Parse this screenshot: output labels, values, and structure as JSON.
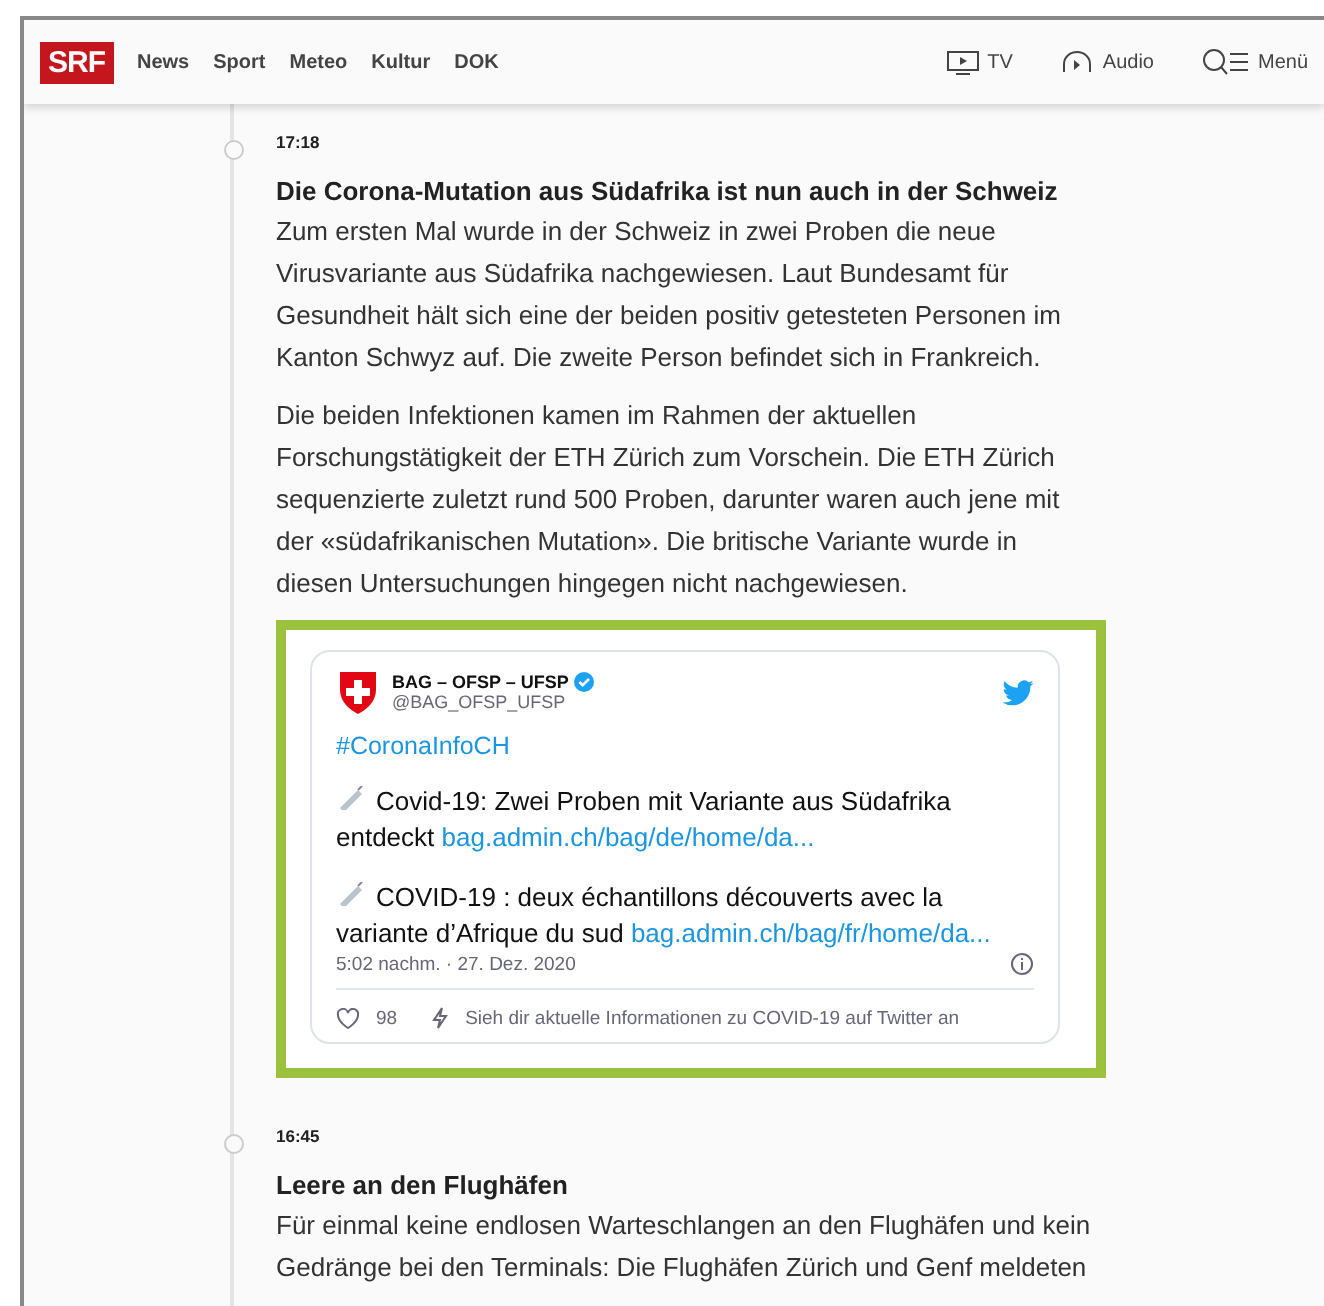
{
  "header": {
    "logo": "SRF",
    "nav": [
      "News",
      "Sport",
      "Meteo",
      "Kultur",
      "DOK"
    ],
    "actions": [
      {
        "kind": "tv",
        "label": "TV"
      },
      {
        "kind": "audio",
        "label": "Audio"
      },
      {
        "kind": "menu",
        "label": "Menü"
      }
    ]
  },
  "entries": [
    {
      "time": "17:18",
      "title": "Die Corona-Mutation aus Südafrika ist nun auch in der Schweiz",
      "paragraphs": [
        "Zum ersten Mal wurde in der Schweiz in zwei Proben die neue Virusvariante aus Südafrika nachgewiesen. Laut Bundesamt für Gesundheit hält sich eine der beiden positiv getesteten Personen im Kanton Schwyz auf. Die zweite Person befindet sich in Frankreich.",
        "Die beiden Infektionen kamen im Rahmen der aktuellen Forschungstätigkeit der ETH Zürich zum Vorschein. Die ETH Zürich sequenzierte zuletzt rund 500 Proben, darunter waren auch jene mit der «südafrikanischen Mutation». Die britische Variante wurde in diesen Untersuchungen hingegen nicht nachgewiesen."
      ],
      "tweet": {
        "name": "BAG – OFSP – UFSP",
        "verified": true,
        "handle": "@BAG_OFSP_UFSP",
        "hashtag": "#CoronaInfoCH",
        "items": [
          {
            "text": "Covid-19: Zwei Proben mit Variante aus Südafrika entdeckt",
            "link": "bag.admin.ch/bag/de/home/da..."
          },
          {
            "text": "COVID-19 : deux échantillons découverts avec la variante d’Afrique du sud",
            "link": "bag.admin.ch/bag/fr/home/da..."
          }
        ],
        "timestamp": "5:02 nachm. · 27. Dez. 2020",
        "likes": "98",
        "cta": "Sieh dir aktuelle Informationen zu COVID-19 auf Twitter an"
      }
    },
    {
      "time": "16:45",
      "title": "Leere an den Flughäfen",
      "paragraphs": [
        "Für einmal keine endlosen Warteschlangen an den Flughäfen und kein Gedränge bei den Terminals: Die Flughäfen Zürich und Genf meldeten"
      ]
    }
  ]
}
